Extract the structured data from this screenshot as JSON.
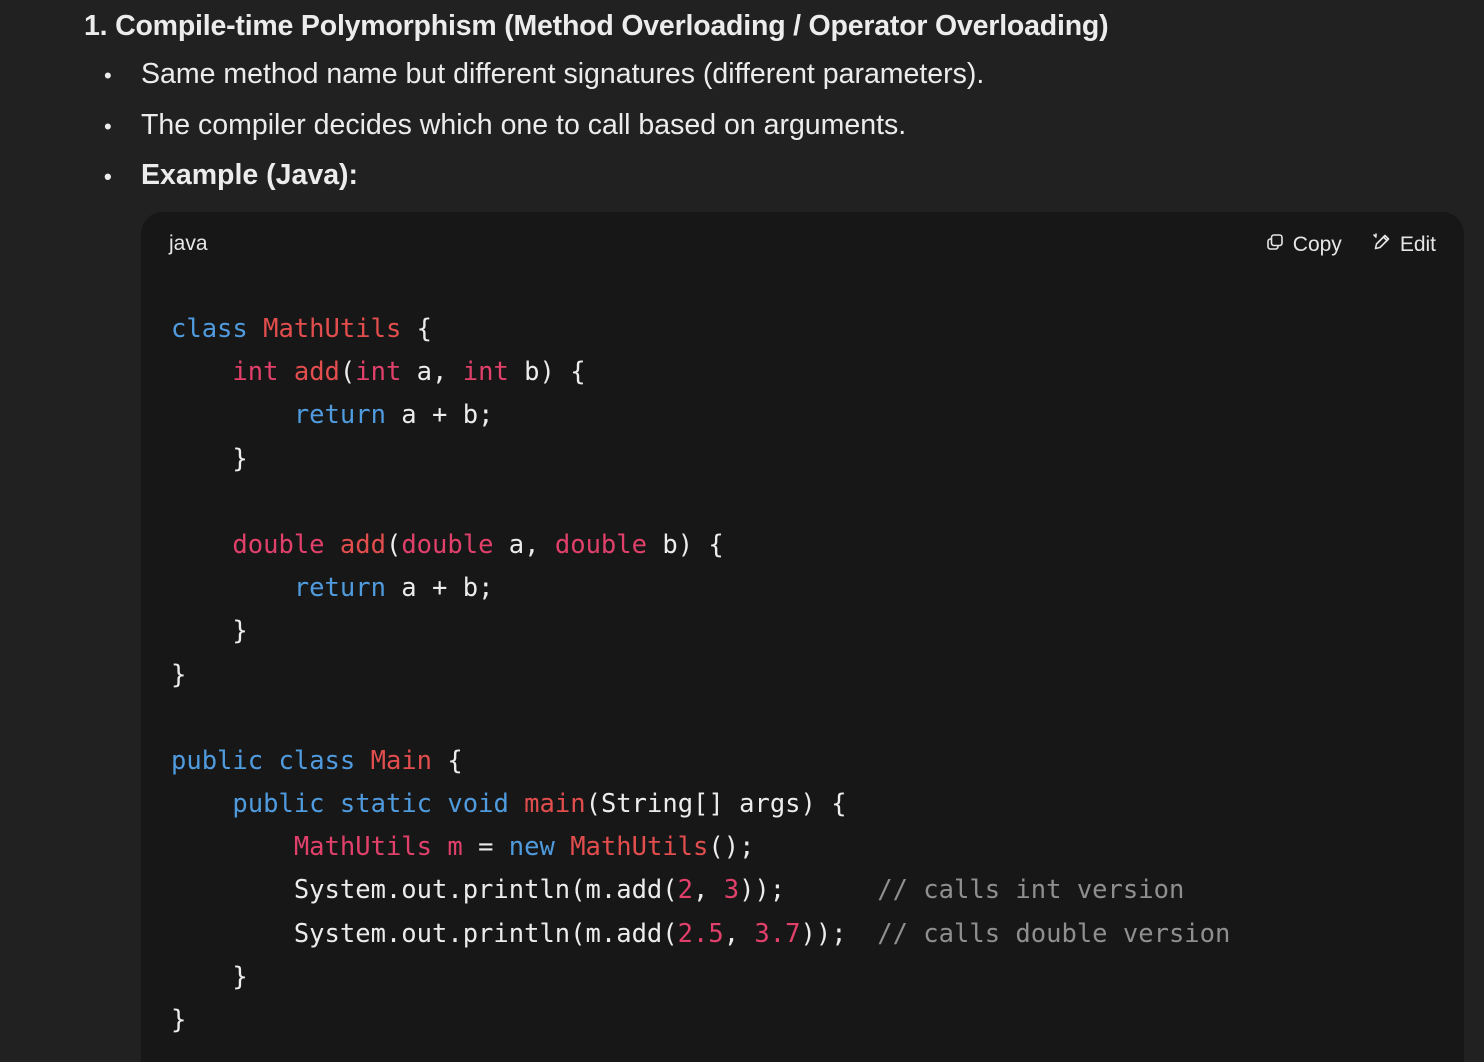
{
  "heading": "1. Compile-time Polymorphism (Method Overloading / Operator Overloading)",
  "bullets": [
    "Same method name but different signatures (different parameters).",
    "The compiler decides which one to call based on arguments.",
    "Example (Java):"
  ],
  "bullet_glyph": "•",
  "code_block": {
    "language": "java",
    "copy_label": "Copy",
    "edit_label": "Edit",
    "lines": [
      [
        {
          "t": "class",
          "c": "kw"
        },
        {
          "t": " "
        },
        {
          "t": "MathUtils",
          "c": "cls"
        },
        {
          "t": " {"
        }
      ],
      [
        {
          "t": "    "
        },
        {
          "t": "int",
          "c": "ty"
        },
        {
          "t": " "
        },
        {
          "t": "add",
          "c": "cls"
        },
        {
          "t": "("
        },
        {
          "t": "int",
          "c": "ty"
        },
        {
          "t": " a, "
        },
        {
          "t": "int",
          "c": "ty"
        },
        {
          "t": " b) {"
        }
      ],
      [
        {
          "t": "        "
        },
        {
          "t": "return",
          "c": "kw"
        },
        {
          "t": " a + b;"
        }
      ],
      [
        {
          "t": "    }"
        }
      ],
      [],
      [
        {
          "t": "    "
        },
        {
          "t": "double",
          "c": "ty"
        },
        {
          "t": " "
        },
        {
          "t": "add",
          "c": "cls"
        },
        {
          "t": "("
        },
        {
          "t": "double",
          "c": "ty"
        },
        {
          "t": " a, "
        },
        {
          "t": "double",
          "c": "ty"
        },
        {
          "t": " b) {"
        }
      ],
      [
        {
          "t": "        "
        },
        {
          "t": "return",
          "c": "kw"
        },
        {
          "t": " a + b;"
        }
      ],
      [
        {
          "t": "    }"
        }
      ],
      [
        {
          "t": "}"
        }
      ],
      [],
      [
        {
          "t": "public",
          "c": "kw"
        },
        {
          "t": " "
        },
        {
          "t": "class",
          "c": "kw"
        },
        {
          "t": " "
        },
        {
          "t": "Main",
          "c": "cls"
        },
        {
          "t": " {"
        }
      ],
      [
        {
          "t": "    "
        },
        {
          "t": "public",
          "c": "kw"
        },
        {
          "t": " "
        },
        {
          "t": "static",
          "c": "kw"
        },
        {
          "t": " "
        },
        {
          "t": "void",
          "c": "kw"
        },
        {
          "t": " "
        },
        {
          "t": "main",
          "c": "cls"
        },
        {
          "t": "(String[] args) {"
        }
      ],
      [
        {
          "t": "        "
        },
        {
          "t": "MathUtils",
          "c": "ty"
        },
        {
          "t": " "
        },
        {
          "t": "m",
          "c": "ty"
        },
        {
          "t": " = "
        },
        {
          "t": "new",
          "c": "kw"
        },
        {
          "t": " "
        },
        {
          "t": "MathUtils",
          "c": "cls"
        },
        {
          "t": "();"
        }
      ],
      [
        {
          "t": "        System.out.println(m.add("
        },
        {
          "t": "2",
          "c": "num"
        },
        {
          "t": ", "
        },
        {
          "t": "3",
          "c": "num"
        },
        {
          "t": "));      "
        },
        {
          "t": "// calls int version",
          "c": "cm"
        }
      ],
      [
        {
          "t": "        System.out.println(m.add("
        },
        {
          "t": "2.5",
          "c": "num"
        },
        {
          "t": ", "
        },
        {
          "t": "3.7",
          "c": "num"
        },
        {
          "t": "));  "
        },
        {
          "t": "// calls double version",
          "c": "cm"
        }
      ],
      [
        {
          "t": "    }"
        }
      ],
      [
        {
          "t": "}"
        }
      ]
    ]
  },
  "colors": {
    "page_bg": "#212121",
    "code_bg": "#171717",
    "keyword": "#4f9bde",
    "type": "#e0406a",
    "class_name": "#e24d4d",
    "comment": "#8f8f8f"
  }
}
